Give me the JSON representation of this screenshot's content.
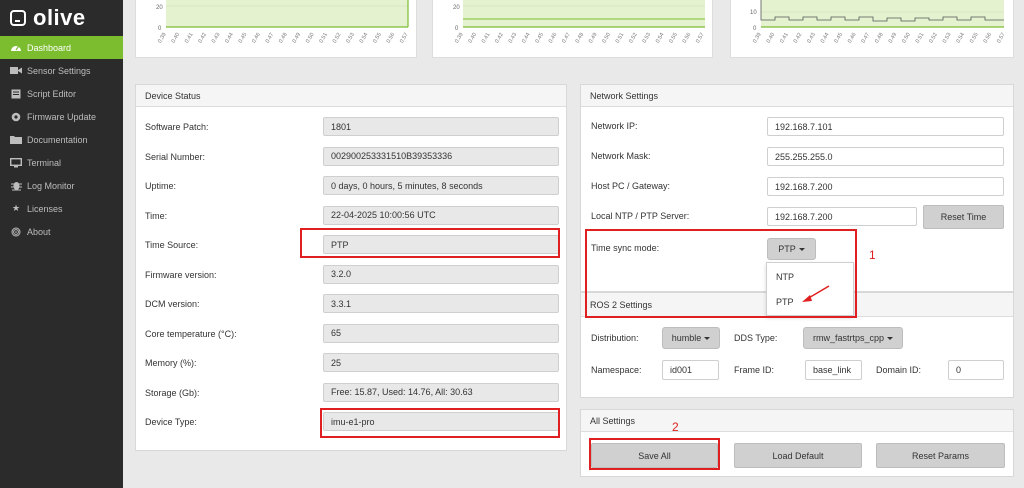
{
  "app": {
    "logo_text": "olive"
  },
  "sidebar": {
    "items": [
      {
        "label": "Dashboard",
        "icon": "dashboard-icon",
        "active": true
      },
      {
        "label": "Sensor Settings",
        "icon": "video-camera-icon"
      },
      {
        "label": "Script Editor",
        "icon": "script-icon"
      },
      {
        "label": "Firmware Update",
        "icon": "gear-icon"
      },
      {
        "label": "Documentation",
        "icon": "folder-icon"
      },
      {
        "label": "Terminal",
        "icon": "monitor-icon"
      },
      {
        "label": "Log Monitor",
        "icon": "bug-icon"
      },
      {
        "label": "Licenses",
        "icon": "star-icon"
      },
      {
        "label": "About",
        "icon": "fingerprint-icon"
      }
    ]
  },
  "charts": {
    "x_ticks": [
      "0.39",
      "0.40",
      "0.41",
      "0.42",
      "0.43",
      "0.44",
      "0.45",
      "0.46",
      "0.47",
      "0.48",
      "0.49",
      "0.50",
      "0.51",
      "0.52",
      "0.53",
      "0.54",
      "0.55",
      "0.56",
      "0.57"
    ],
    "chart1": {
      "y_tick": "20",
      "y_tick0": "0"
    },
    "chart2": {
      "y_tick": "20",
      "y_tick0": "0"
    },
    "chart3": {
      "y_tick": "10",
      "y_tick0": "0"
    }
  },
  "device_status": {
    "title": "Device Status",
    "rows": [
      {
        "label": "Software Patch:",
        "value": "1801"
      },
      {
        "label": "Serial Number:",
        "value": "002900253331510B39353336"
      },
      {
        "label": "Uptime:",
        "value": "0 days, 0 hours, 5 minutes, 8 seconds"
      },
      {
        "label": "Time:",
        "value": "22-04-2025 10:00:56 UTC"
      },
      {
        "label": "Time Source:",
        "value": "PTP"
      },
      {
        "label": "Firmware version:",
        "value": "3.2.0"
      },
      {
        "label": "DCM version:",
        "value": "3.3.1"
      },
      {
        "label": "Core temperature (°C):",
        "value": "65"
      },
      {
        "label": "Memory (%):",
        "value": "25"
      },
      {
        "label": "Storage (Gb):",
        "value": "Free: 15.87, Used: 14.76, All: 30.63"
      },
      {
        "label": "Device Type:",
        "value": "imu-e1-pro"
      }
    ]
  },
  "network": {
    "title": "Network Settings",
    "ip_label": "Network IP:",
    "ip_value": "192.168.7.101",
    "mask_label": "Network Mask:",
    "mask_value": "255.255.255.0",
    "gateway_label": "Host PC / Gateway:",
    "gateway_value": "192.168.7.200",
    "ntp_label": "Local NTP / PTP Server:",
    "ntp_value": "192.168.7.200",
    "reset_time_label": "Reset Time",
    "sync_label": "Time sync mode:",
    "sync_value": "PTP",
    "sync_options": [
      "NTP",
      "PTP"
    ]
  },
  "ros2": {
    "title": "ROS 2 Settings",
    "distribution_label": "Distribution:",
    "distribution_value": "humble",
    "dds_label": "DDS Type:",
    "dds_value": "rmw_fastrtps_cpp",
    "namespace_label": "Namespace:",
    "namespace_value": "id001",
    "frame_label": "Frame ID:",
    "frame_value": "base_link",
    "domain_label": "Domain ID:",
    "domain_value": "0"
  },
  "all_settings": {
    "title": "All Settings",
    "save_label": "Save All",
    "load_label": "Load Default",
    "reset_label": "Reset Params"
  },
  "annotations": {
    "one": "1",
    "two": "2"
  },
  "colors": {
    "accent": "#7cbd30",
    "highlight": "#e02020"
  }
}
